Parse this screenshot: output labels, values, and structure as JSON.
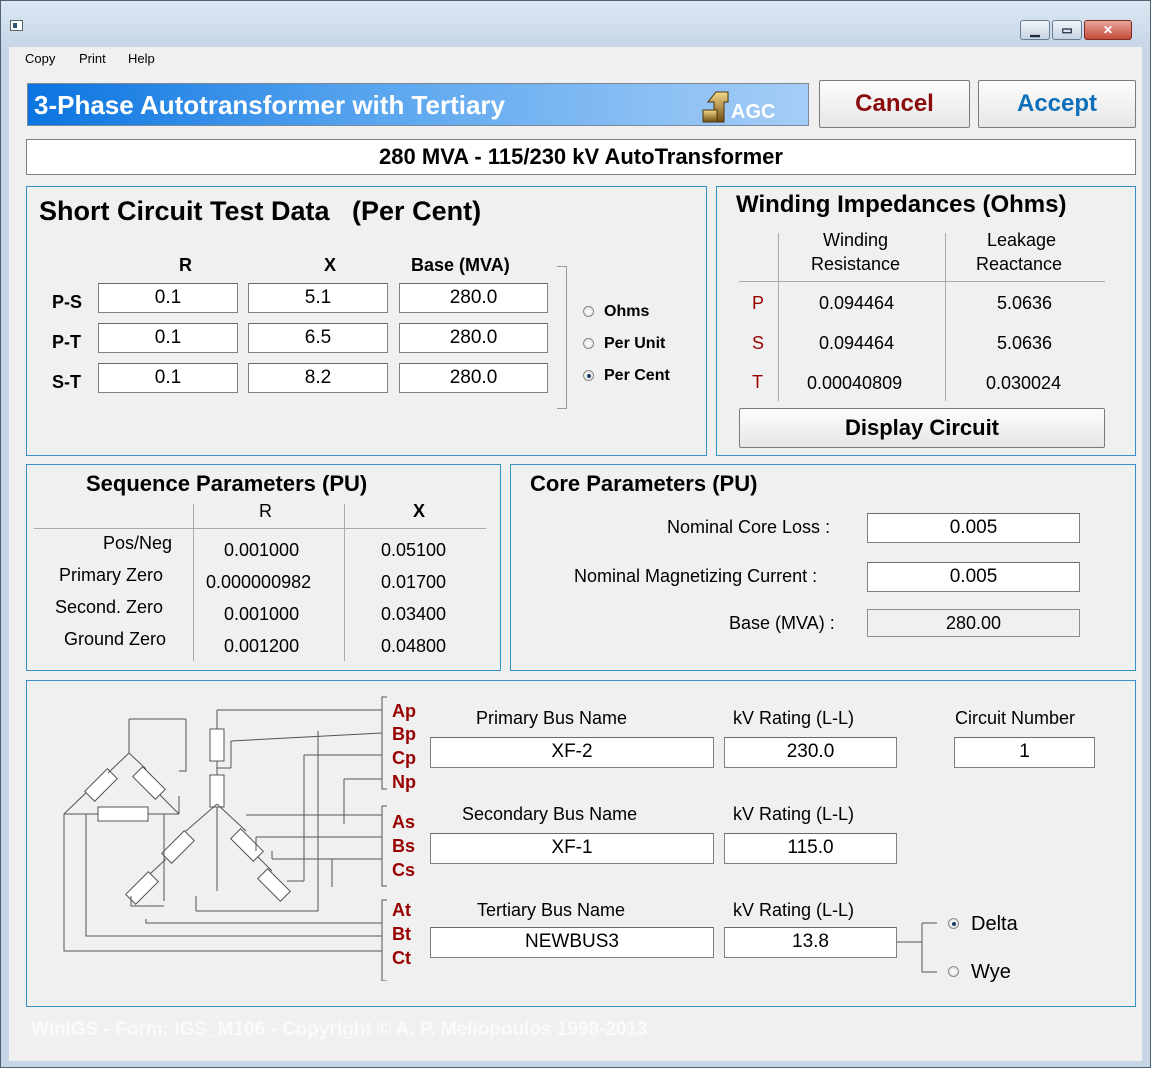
{
  "window": {
    "min_icon": "minimize-icon",
    "max_icon": "maximize-icon",
    "close_icon": "close-icon",
    "min_glyph": "▁",
    "max_glyph": "▭",
    "close_glyph": "✕"
  },
  "menu": [
    "Copy",
    "Print",
    "Help"
  ],
  "header": {
    "title": "3-Phase Autotransformer with Tertiary",
    "logo_text": "AGC",
    "cancel_label": "Cancel",
    "accept_label": "Accept"
  },
  "description": "280 MVA - 115/230 kV AutoTransformer",
  "short_circuit": {
    "title": "Short Circuit Test Data   (Per Cent)",
    "col_r": "R",
    "col_x": "X",
    "col_base": "Base (MVA)",
    "rows": [
      {
        "label": "P-S",
        "r": "0.1",
        "x": "5.1",
        "base": "280.0"
      },
      {
        "label": "P-T",
        "r": "0.1",
        "x": "6.5",
        "base": "280.0"
      },
      {
        "label": "S-T",
        "r": "0.1",
        "x": "8.2",
        "base": "280.0"
      }
    ],
    "units": [
      {
        "label": "Ohms",
        "selected": false
      },
      {
        "label": "Per Unit",
        "selected": false
      },
      {
        "label": "Per Cent",
        "selected": true
      }
    ]
  },
  "winding": {
    "title": "Winding Impedances (Ohms)",
    "col_res": "Winding Resistance",
    "col_res_1": "Winding",
    "col_res_2": "Resistance",
    "col_react_1": "Leakage",
    "col_react_2": "Reactance",
    "rows": [
      {
        "label": "P",
        "r": "0.094464",
        "x": "5.0636"
      },
      {
        "label": "S",
        "r": "0.094464",
        "x": "5.0636"
      },
      {
        "label": "T",
        "r": "0.00040809",
        "x": "0.030024"
      }
    ],
    "display_button": "Display Circuit"
  },
  "sequence": {
    "title": "Sequence Parameters (PU)",
    "col_r": "R",
    "col_x": "X",
    "rows": [
      {
        "label": "Pos/Neg",
        "r": "0.001000",
        "x": "0.05100"
      },
      {
        "label": "Primary Zero",
        "r": "0.000000982",
        "x": "0.01700"
      },
      {
        "label": "Second. Zero",
        "r": "0.001000",
        "x": "0.03400"
      },
      {
        "label": "Ground Zero",
        "r": "0.001200",
        "x": "0.04800"
      }
    ]
  },
  "core": {
    "title": "Core Parameters (PU)",
    "core_loss_label": "Nominal Core Loss :",
    "core_loss": "0.005",
    "mag_label": "Nominal Magnetizing Current :",
    "mag": "0.005",
    "base_label": "Base (MVA) :",
    "base": "280.00"
  },
  "buses": {
    "terminals": [
      "Ap",
      "Bp",
      "Cp",
      "Np",
      "As",
      "Bs",
      "Cs",
      "At",
      "Bt",
      "Ct"
    ],
    "primary_label": "Primary Bus Name",
    "primary": "XF-2",
    "secondary_label": "Secondary Bus Name",
    "secondary": "XF-1",
    "tertiary_label": "Tertiary Bus Name",
    "tertiary": "NEWBUS3",
    "kv_label": "kV Rating (L-L)",
    "kv_primary": "230.0",
    "kv_secondary": "115.0",
    "kv_tertiary": "13.8",
    "circuit_label": "Circuit Number",
    "circuit": "1",
    "connection": [
      {
        "label": "Delta",
        "selected": true
      },
      {
        "label": "Wye",
        "selected": false
      }
    ]
  },
  "footer": "WinIGS - Form: IGS_M106 - Copyright © A. P. Meliopoulos 1998-2013"
}
